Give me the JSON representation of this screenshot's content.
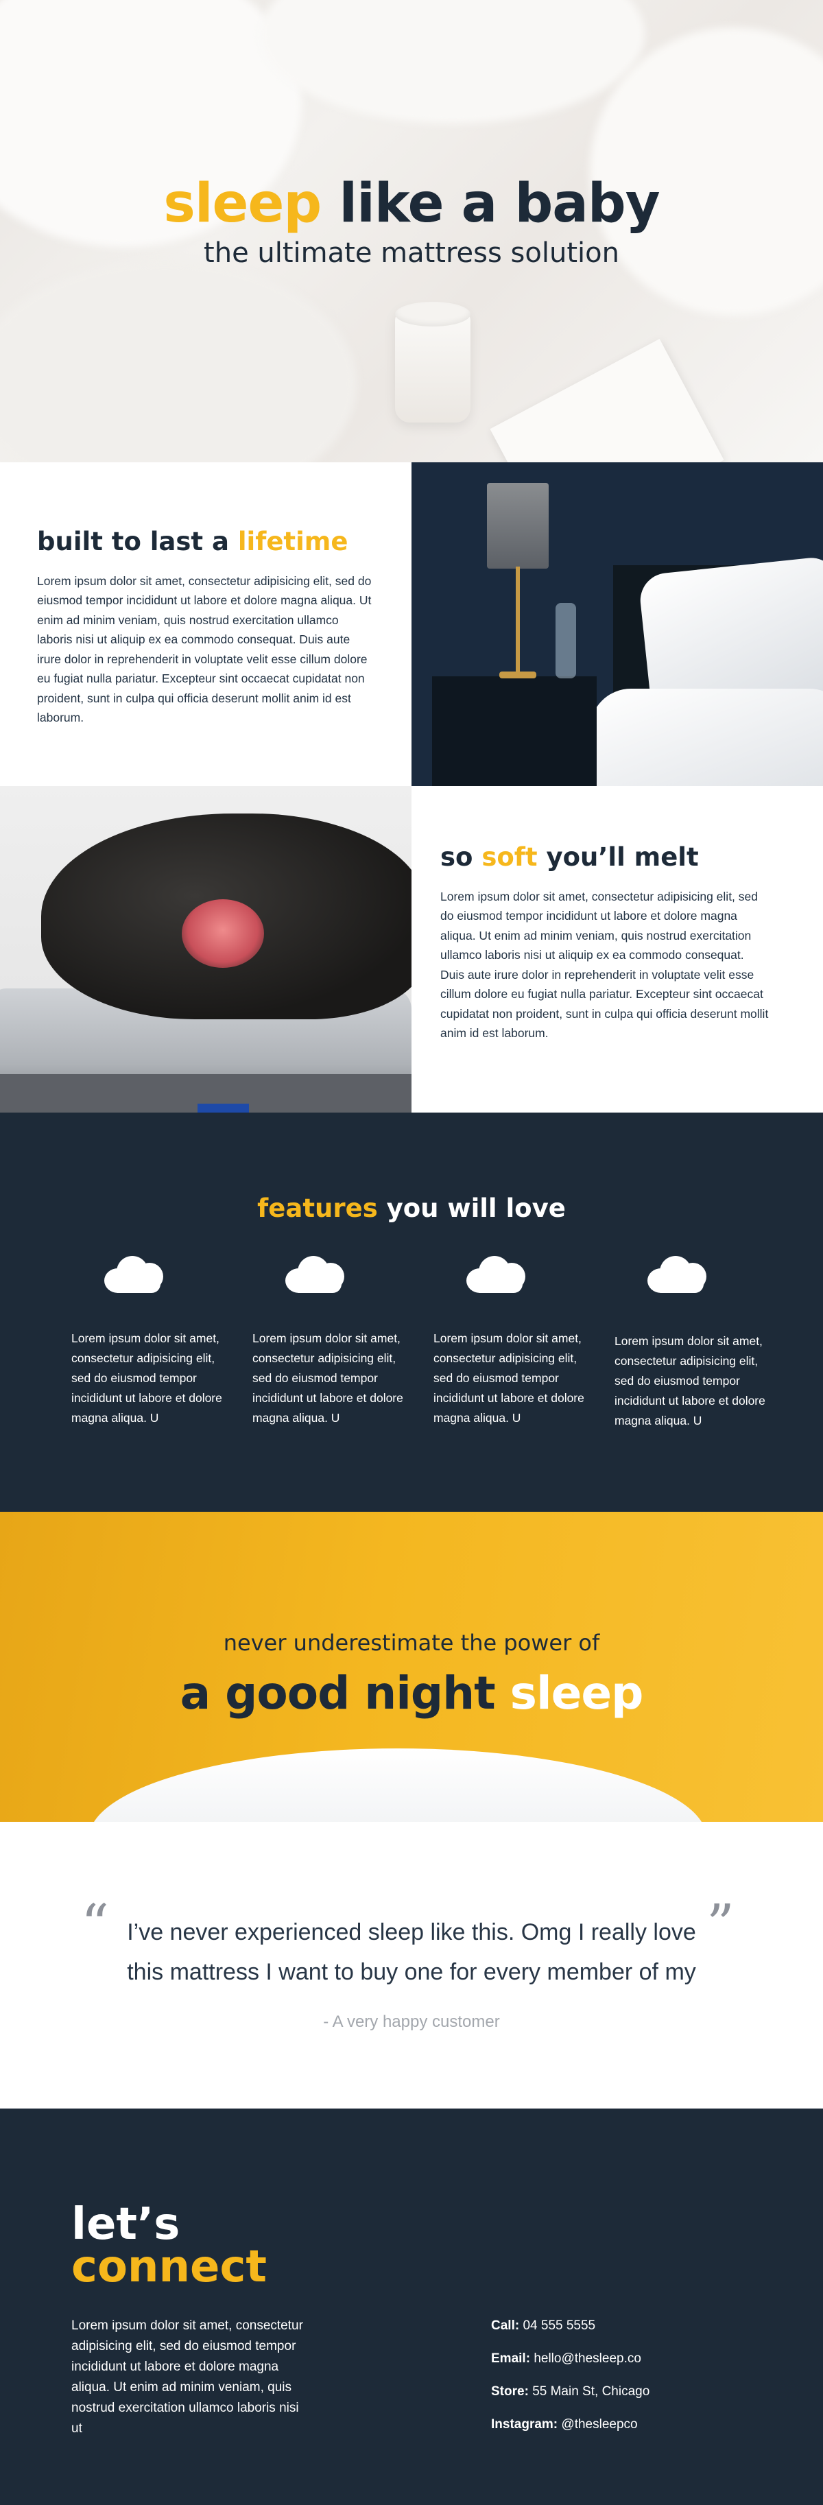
{
  "hero": {
    "title_accent": "sleep",
    "title_rest": "like a baby",
    "subtitle": "the ultimate mattress solution"
  },
  "section_lifetime": {
    "heading_main": "built to last a",
    "heading_accent": "lifetime",
    "body": "Lorem ipsum dolor sit amet, consectetur adipisicing elit, sed do eiusmod tempor incididunt ut labore et dolore magna aliqua. Ut enim ad minim veniam, quis nostrud exercitation ullamco laboris nisi ut aliquip ex ea commodo consequat. Duis aute irure dolor in reprehenderit in voluptate velit esse cillum dolore eu fugiat nulla pariatur. Excepteur sint occaecat cupidatat non proident, sunt in culpa qui officia deserunt mollit anim id est laborum."
  },
  "section_soft": {
    "heading_pre": "so",
    "heading_accent": "soft",
    "heading_post": "you’ll melt",
    "body": "Lorem ipsum dolor sit amet, consectetur adipisicing elit, sed do eiusmod tempor incididunt ut labore et dolore magna aliqua. Ut enim ad minim veniam, quis nostrud exercitation ullamco laboris nisi ut aliquip ex ea commodo consequat. Duis aute irure dolor in reprehenderit in voluptate velit esse cillum dolore eu fugiat nulla pariatur. Excepteur sint occaecat cupidatat non proident, sunt in culpa qui officia deserunt mollit anim id est laborum."
  },
  "features": {
    "title_accent": "features",
    "title_rest": "you will love",
    "icon": "cloud-icon",
    "items": [
      {
        "text": "Lorem ipsum dolor sit amet, consectetur adipisicing elit, sed do eiusmod tempor incididunt ut labore et dolore magna aliqua. U"
      },
      {
        "text": "Lorem ipsum dolor sit amet, consectetur adipisicing elit, sed do eiusmod tempor incididunt ut labore et dolore magna aliqua. U"
      },
      {
        "text": "Lorem ipsum dolor sit amet, consectetur adipisicing elit, sed do eiusmod tempor incididunt ut labore et dolore magna aliqua. U"
      },
      {
        "text": "Lorem ipsum dolor sit amet, consectetur adipisicing elit, sed do eiusmod tempor incididunt ut labore et dolore magna aliqua. U"
      }
    ]
  },
  "banner": {
    "pre": "never underestimate the power of",
    "big_dark": "a good night",
    "big_light": "sleep"
  },
  "testimonial": {
    "open_quote": "“",
    "close_quote": "”",
    "text": "I’ve never experienced sleep like this. Omg I really love this mattress I want to buy one for every member of my",
    "author": "- A very happy customer"
  },
  "contact": {
    "title_line1": "let’s",
    "title_line2": "connect",
    "body": "Lorem ipsum dolor sit amet, consectetur adipisicing elit, sed do eiusmod tempor incididunt ut labore et dolore magna aliqua. Ut enim ad minim veniam, quis nostrud exercitation ullamco laboris nisi ut",
    "items": [
      {
        "label": "Call:",
        "value": "04 555 5555"
      },
      {
        "label": "Email:",
        "value": "hello@thesleep.co"
      },
      {
        "label": "Store:",
        "value": "55 Main St, Chicago"
      },
      {
        "label": "Instagram:",
        "value": "@thesleepco"
      }
    ]
  },
  "colors": {
    "accent": "#f6b71c",
    "navy": "#1d2a38",
    "white": "#ffffff"
  }
}
